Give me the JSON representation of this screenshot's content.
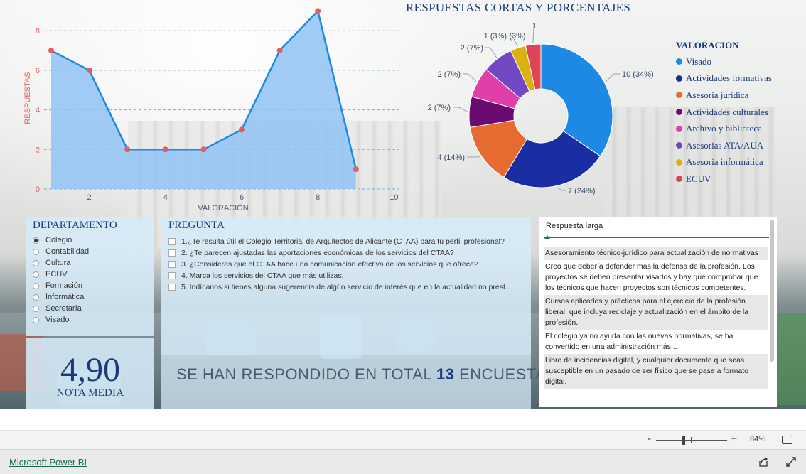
{
  "area_chart": {
    "ylabel": "RESPUESTAS",
    "xlabel": "VALORACIÓN",
    "y_ticks": [
      "0",
      "2",
      "4",
      "6",
      "8"
    ],
    "x_ticks": [
      "2",
      "4",
      "6",
      "8",
      "10"
    ]
  },
  "pie_chart": {
    "title": "RESPUESTAS CORTAS Y PORCENTAJES",
    "legend_title": "VALORACIÓN",
    "slices": [
      {
        "name": "Visado",
        "label": "10 (34%)",
        "color": "#1e88e5"
      },
      {
        "name": "Actividades formativas",
        "label": "7 (24%)",
        "color": "#1a2ea3"
      },
      {
        "name": "Asesoría jurídica",
        "label": "4 (14%)",
        "color": "#e56b30"
      },
      {
        "name": "Actividades culturales",
        "label": "2 (7%)",
        "color": "#6a0b72"
      },
      {
        "name": "Archivo y biblioteca",
        "label": "2 (7%)",
        "color": "#df3fa7"
      },
      {
        "name": "Asesorías ATA/AUA",
        "label": "2 (7%)",
        "color": "#7048c2"
      },
      {
        "name": "Asesoría informática",
        "label": "1 (3%)",
        "color": "#dbb10d"
      },
      {
        "name": "ECUV",
        "label": "1",
        "label2": "(3%)",
        "color": "#dd4455"
      }
    ]
  },
  "chart_data": [
    {
      "type": "area",
      "x": [
        1,
        2,
        3,
        4,
        5,
        6,
        7,
        8,
        9
      ],
      "series": [
        {
          "values": [
            7,
            6,
            2,
            2,
            2,
            3,
            7,
            9,
            1
          ]
        }
      ],
      "xlabel": "VALORACIÓN",
      "ylabel": "RESPUESTAS",
      "xlim": [
        0.5,
        10
      ],
      "ylim": [
        0,
        9
      ],
      "grid": true,
      "colors": {
        "fill": "#8fc3f5",
        "line": "#1e88e5",
        "marker": "#e06060"
      }
    },
    {
      "type": "pie",
      "title": "RESPUESTAS CORTAS Y PORCENTAJES",
      "categories": [
        "Visado",
        "Actividades formativas",
        "Asesoría jurídica",
        "Actividades culturales",
        "Archivo y biblioteca",
        "Asesorías ATA/AUA",
        "Asesoría informática",
        "ECUV"
      ],
      "values": [
        10,
        7,
        4,
        2,
        2,
        2,
        1,
        1
      ],
      "legend": "right"
    }
  ],
  "departamento": {
    "title": "DEPARTAMENTO",
    "options": [
      {
        "label": "Colegio",
        "selected": true
      },
      {
        "label": "Contabilidad",
        "selected": false
      },
      {
        "label": "Cultura",
        "selected": false
      },
      {
        "label": "ECUV",
        "selected": false
      },
      {
        "label": "Formación",
        "selected": false
      },
      {
        "label": "Informática",
        "selected": false
      },
      {
        "label": "Secretaría",
        "selected": false
      },
      {
        "label": "Visado",
        "selected": false
      }
    ]
  },
  "pregunta": {
    "title": "PREGUNTA",
    "options": [
      "1.¿Te resulta útil el Colegio Territorial de Arquitectos de Alicante (CTAA) para tu perfil profesional?",
      "2. ¿Te parecen ajustadas las aportaciones económicas de los servicios del CTAA?",
      "3. ¿Consideras que el CTAA hace una comunicación efectiva de los servicios que ofrece?",
      "4. Marca los servicios del CTAA que más utilizas:",
      "5. Indícanos si tienes alguna sugerencia de algún servicio de interés que en la actualidad no prest..."
    ]
  },
  "kpi": {
    "value": "4,90",
    "label": "NOTA MEDIA"
  },
  "total": {
    "prefix": "SE HAN RESPONDIDO EN TOTAL",
    "count": "13",
    "suffix": "ENCUESTAS"
  },
  "answers": {
    "header": "Respuesta larga",
    "rows": [
      "Asesoramiento técnico-jurídico para actualización de normativas",
      "Creo que debería defender mas la defensa de la profesión. Los proyectos se deben presentar visados y hay que comprobar que los técnicos que hacen proyectos son técnicos competentes.",
      "Cursos aplicados y prácticos para el ejercicio de la profesión liberal, que incluya reciclaje y actualización en el ámbito de la profesión.",
      "El colegio ya no ayuda con las nuevas normativas, se ha convertido en una administración más...",
      "Libro de incidencias digital, y cualquier documento que seas susceptible en un pasado de ser físico que se pase a formato digital."
    ]
  },
  "footer": {
    "zoom_minus": "-",
    "zoom_plus": "+",
    "zoom_percent": "84%",
    "brand": "Microsoft Power BI"
  }
}
